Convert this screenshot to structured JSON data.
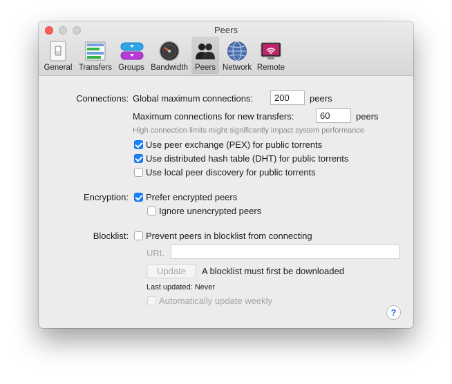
{
  "window": {
    "title": "Peers"
  },
  "toolbar": {
    "tabs": [
      {
        "label": "General",
        "icon": "light-switch-icon",
        "active": false
      },
      {
        "label": "Transfers",
        "icon": "transfers-list-icon",
        "active": false
      },
      {
        "label": "Groups",
        "icon": "groups-icon",
        "active": false
      },
      {
        "label": "Bandwidth",
        "icon": "speedometer-icon",
        "active": false
      },
      {
        "label": "Peers",
        "icon": "people-icon",
        "active": true
      },
      {
        "label": "Network",
        "icon": "globe-icon",
        "active": false
      },
      {
        "label": "Remote",
        "icon": "remote-screen-icon",
        "active": false
      }
    ]
  },
  "connections": {
    "section_label": "Connections:",
    "global_label": "Global maximum connections:",
    "global_value": "200",
    "global_unit": "peers",
    "new_label": "Maximum connections for new transfers:",
    "new_value": "60",
    "new_unit": "peers",
    "hint": "High connection limits might significantly impact system performance",
    "pex": {
      "label": "Use peer exchange (PEX) for public torrents",
      "checked": true
    },
    "dht": {
      "label": "Use distributed hash table (DHT) for public torrents",
      "checked": true
    },
    "lpd": {
      "label": "Use local peer discovery for public torrents",
      "checked": false
    }
  },
  "encryption": {
    "section_label": "Encryption:",
    "prefer": {
      "label": "Prefer encrypted peers",
      "checked": true
    },
    "ignore": {
      "label": "Ignore unencrypted peers",
      "checked": false
    }
  },
  "blocklist": {
    "section_label": "Blocklist:",
    "prevent": {
      "label": "Prevent peers in blocklist from connecting",
      "checked": false
    },
    "url_label": "URL",
    "url_value": "",
    "update_button": "Update",
    "update_note": "A blocklist must first be downloaded",
    "last_updated": "Last updated: Never",
    "auto_update": {
      "label": "Automatically update weekly",
      "checked": false
    }
  },
  "help": {
    "label": "?"
  },
  "colors": {
    "accent": "#1a82fb",
    "close": "#fc5f57",
    "window_bg": "#ececec"
  }
}
